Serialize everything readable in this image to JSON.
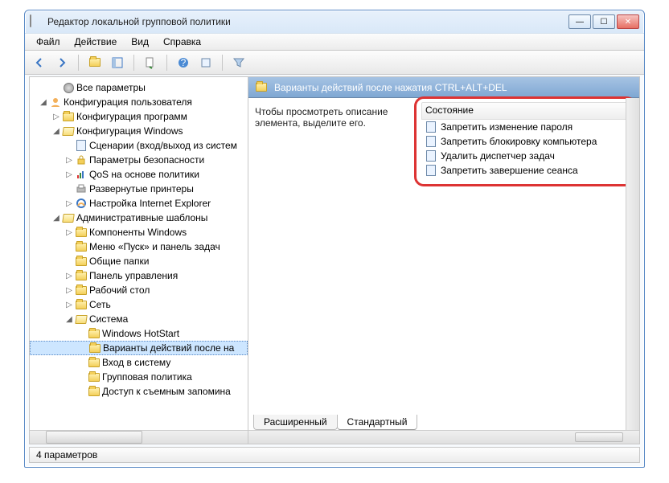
{
  "window": {
    "title": "Редактор локальной групповой политики"
  },
  "menu": {
    "file": "Файл",
    "action": "Действие",
    "view": "Вид",
    "help": "Справка"
  },
  "toolbar_icons": [
    "back",
    "forward",
    "up",
    "show-hide-tree",
    "export",
    "help",
    "properties",
    "filter"
  ],
  "tree": {
    "root1": "Все параметры",
    "user_cfg": "Конфигурация пользователя",
    "soft_cfg": "Конфигурация программ",
    "win_cfg": "Конфигурация Windows",
    "scripts": "Сценарии (вход/выход из систем",
    "sec": "Параметры безопасности",
    "qos": "QoS на основе политики",
    "printers": "Развернутые принтеры",
    "ie": "Настройка Internet Explorer",
    "admin_tmpl": "Административные шаблоны",
    "comp_win": "Компоненты Windows",
    "start_tb": "Меню «Пуск» и панель задач",
    "shared": "Общие папки",
    "cpanel": "Панель управления",
    "desktop": "Рабочий стол",
    "network": "Сеть",
    "system": "Система",
    "hotstart": "Windows HotStart",
    "cad": "Варианты действий после на",
    "logon": "Вход в систему",
    "gpolicy": "Групповая политика",
    "removable": "Доступ к съемным запомина"
  },
  "right": {
    "header": "Варианты действий после нажатия CTRL+ALT+DEL",
    "description": "Чтобы просмотреть описание элемента, выделите его.",
    "column": "Состояние",
    "items": [
      "Запретить изменение пароля",
      "Запретить блокировку компьютера",
      "Удалить диспетчер задач",
      "Запретить завершение сеанса"
    ],
    "tab_ext": "Расширенный",
    "tab_std": "Стандартный"
  },
  "status": "4 параметров"
}
